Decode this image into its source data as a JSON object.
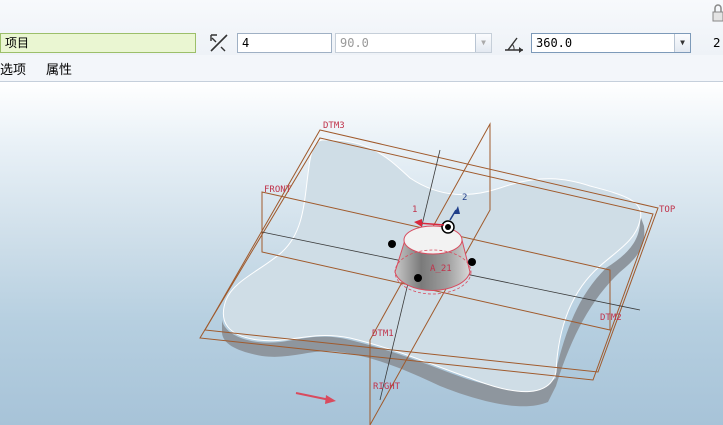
{
  "toolbar": {
    "selection_field": "项目",
    "depth_value": "4",
    "angle_value": "90.0",
    "revolve_angle": "360.0",
    "right_edge_value": "2"
  },
  "menubar": {
    "options": "选项",
    "properties": "属性"
  },
  "model_labels": {
    "dtm3": "DTM3",
    "front": "FRONT",
    "top": "TOP",
    "dtm2": "DTM2",
    "dtm1": "DTM1",
    "right": "RIGHT",
    "axis": "A_21",
    "dim1": "1",
    "dim2": "2"
  },
  "colors": {
    "datum": "#a05a2c",
    "datum_label": "#c0334b",
    "field_green": "#eaf6d2",
    "part_fill": "#cfdde6"
  }
}
